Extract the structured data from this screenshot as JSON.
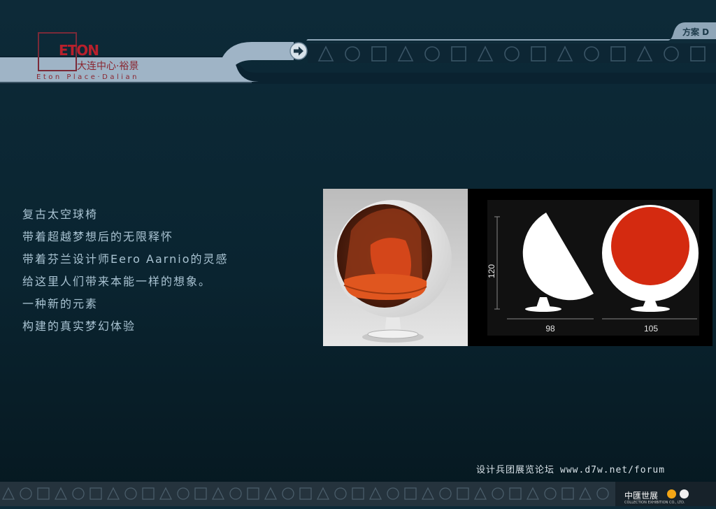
{
  "brand": {
    "logo_mark": "ETON",
    "name_cn": "大连中心·裕景",
    "name_en": "Eton Place·Dalian"
  },
  "header": {
    "plan_label": "方案 D",
    "nav_icon": "arrow-right-icon",
    "pattern": "triangle-circle-square"
  },
  "description": {
    "lines": [
      "复古太空球椅",
      "带着超越梦想后的无限释怀",
      "带着芬兰设计师Eero Aarnio的灵感",
      "给这里人们带来本能一样的想象。",
      "一种新的元素",
      "构建的真实梦幻体验"
    ]
  },
  "diagram": {
    "height_label": "120",
    "side_width_label": "98",
    "front_width_label": "105",
    "shell_color": "#ffffff",
    "inner_color": "#d42a10"
  },
  "photo": {
    "cushion_color": "#d4461a",
    "shell_color": "#f4f4f4"
  },
  "watermark": {
    "text_cn": "设计兵团展览论坛",
    "url": "www.d7w.net/forum"
  },
  "footer": {
    "company_cn": "中匯世展",
    "company_en": "COLLECTION EXHIBITION CO., LTD.",
    "dot_colors": [
      "#f2a515",
      "#f0f0f0"
    ]
  }
}
